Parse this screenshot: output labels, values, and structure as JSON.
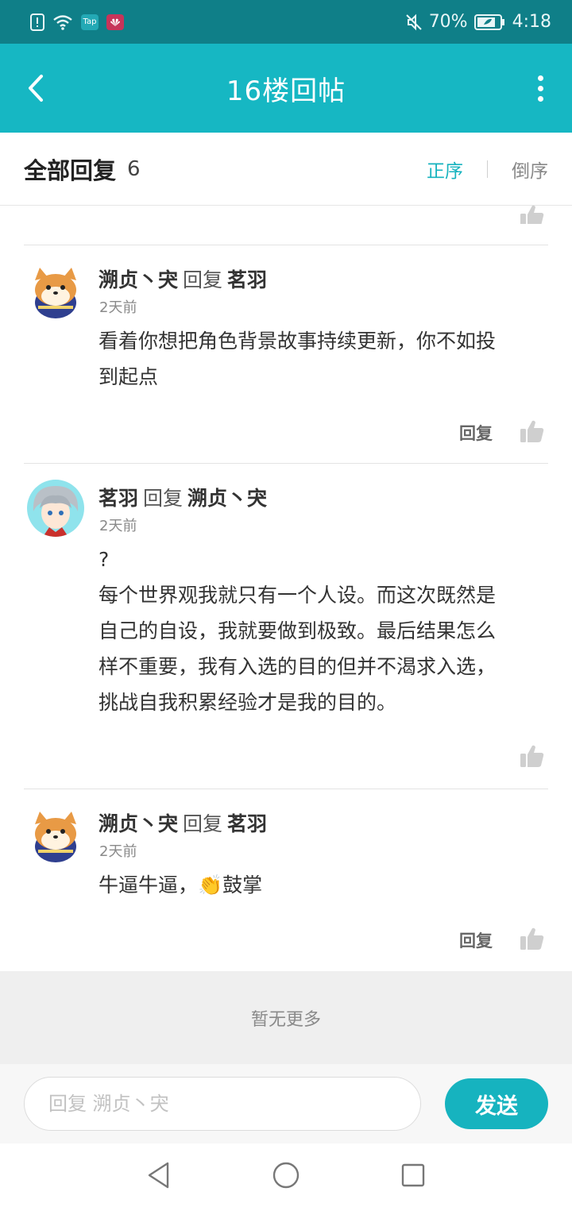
{
  "status_bar": {
    "battery": "70%",
    "time": "4:18",
    "app_badge_1": "Tap"
  },
  "header": {
    "title": "16楼回帖"
  },
  "sort_bar": {
    "title": "全部回复",
    "count": "6",
    "asc_label": "正序",
    "desc_label": "倒序"
  },
  "replies": [
    {
      "author": "溯贞丶宊",
      "verb": "回复",
      "target": "茗羽",
      "time": "2天前",
      "text_lines": [
        "看着你想把角色背景故事持续更新，你不如投",
        "到起点"
      ],
      "reply_label": "回复"
    },
    {
      "author": "茗羽",
      "verb": "回复",
      "target": "溯贞丶宊",
      "time": "2天前",
      "text_lines": [
        "?",
        "每个世界观我就只有一个人设。而这次既然是",
        "自己的自设，我就要做到极致。最后结果怎么",
        "样不重要，我有入选的目的但并不渴求入选，",
        "挑战自我积累经验才是我的目的。"
      ]
    },
    {
      "author": "溯贞丶宊",
      "verb": "回复",
      "target": "茗羽",
      "time": "2天前",
      "text_before": "牛逼牛逼，",
      "emoji": "👏",
      "text_after": "鼓掌",
      "reply_label": "回复"
    }
  ],
  "footer": {
    "no_more": "暂无更多"
  },
  "input_bar": {
    "placeholder": "回复 溯贞丶宊",
    "value": "",
    "send_label": "发送"
  },
  "colors": {
    "status_bar": "#0f7f88",
    "app_bar": "#16b7c3",
    "accent": "#16b3bf"
  }
}
